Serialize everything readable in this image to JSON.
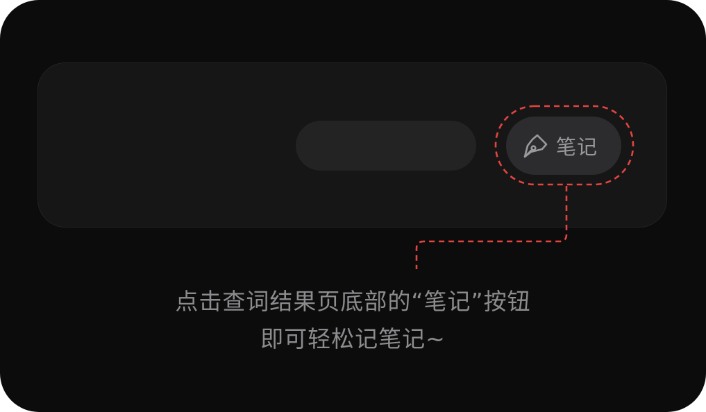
{
  "note_button": {
    "icon": "pen-nib-icon",
    "label": "笔记"
  },
  "annotation": {
    "highlight_color": "#e5443f"
  },
  "caption": {
    "line1": "点击查词结果页底部的“笔记”按钮",
    "line2": "即可轻松记笔记~"
  }
}
